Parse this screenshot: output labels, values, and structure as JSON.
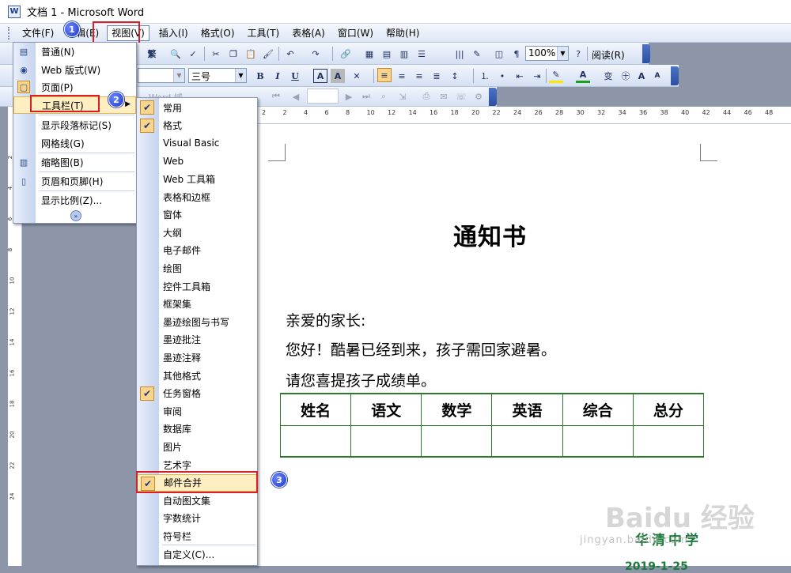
{
  "window": {
    "title": "文档 1 - Microsoft Word",
    "app_icon": "word-icon"
  },
  "menubar": {
    "items": [
      "文件(F)",
      "编辑(E)",
      "视图(V)",
      "插入(I)",
      "格式(O)",
      "工具(T)",
      "表格(A)",
      "窗口(W)",
      "帮助(H)"
    ],
    "active_index": 2
  },
  "toolbar_standard": {
    "fanti": "繁",
    "zoom": "100%",
    "reading": "阅读(R)"
  },
  "toolbar_format": {
    "font_size": "三号",
    "bold": "B",
    "italic": "I",
    "underline": "U",
    "char_border": "A",
    "char_shade": "A",
    "font_color": "A",
    "grow": "A",
    "shrink": "A",
    "phonetic": "变"
  },
  "toolbar_third": {
    "label": "Word 域"
  },
  "view_menu": {
    "items": [
      {
        "label": "普通(N)",
        "icon": "normal-view-icon"
      },
      {
        "label": "Web 版式(W)",
        "icon": "web-layout-icon"
      },
      {
        "label": "页面(P)",
        "icon": "print-layout-icon"
      },
      {
        "label": "工具栏(T)",
        "icon": ""
      },
      {
        "label": "显示段落标记(S)",
        "icon": ""
      },
      {
        "label": "网格线(G)",
        "icon": ""
      },
      {
        "label": "缩略图(B)",
        "icon": "thumbnail-icon"
      },
      {
        "label": "页眉和页脚(H)",
        "icon": "header-footer-icon"
      },
      {
        "label": "显示比例(Z)...",
        "icon": ""
      }
    ],
    "expand_icon": "chevron-double-down-icon"
  },
  "toolbars_submenu": {
    "items": [
      {
        "label": "常用",
        "checked": true
      },
      {
        "label": "格式",
        "checked": true
      },
      {
        "label": "Visual Basic",
        "checked": false
      },
      {
        "label": "Web",
        "checked": false
      },
      {
        "label": "Web 工具箱",
        "checked": false
      },
      {
        "label": "表格和边框",
        "checked": false
      },
      {
        "label": "窗体",
        "checked": false
      },
      {
        "label": "大纲",
        "checked": false
      },
      {
        "label": "电子邮件",
        "checked": false
      },
      {
        "label": "绘图",
        "checked": false
      },
      {
        "label": "控件工具箱",
        "checked": false
      },
      {
        "label": "框架集",
        "checked": false
      },
      {
        "label": "墨迹绘图与书写",
        "checked": false
      },
      {
        "label": "墨迹批注",
        "checked": false
      },
      {
        "label": "墨迹注释",
        "checked": false
      },
      {
        "label": "其他格式",
        "checked": false
      },
      {
        "label": "任务窗格",
        "checked": true
      },
      {
        "label": "审阅",
        "checked": false
      },
      {
        "label": "数据库",
        "checked": false
      },
      {
        "label": "图片",
        "checked": false
      },
      {
        "label": "艺术字",
        "checked": false
      },
      {
        "label": "邮件合并",
        "checked": true
      },
      {
        "label": "自动图文集",
        "checked": false
      },
      {
        "label": "字数统计",
        "checked": false
      },
      {
        "label": "符号栏",
        "checked": false
      },
      {
        "label": "自定义(C)...",
        "checked": false
      }
    ],
    "highlight_index": 21
  },
  "step_badges": [
    "1",
    "2",
    "3"
  ],
  "ruler": {
    "numbers": [
      "2",
      "2",
      "4",
      "6",
      "8",
      "10",
      "12",
      "14",
      "16",
      "18",
      "20",
      "22",
      "24",
      "26",
      "28",
      "30",
      "32",
      "34",
      "36",
      "38",
      "40",
      "42",
      "44",
      "46",
      "48"
    ],
    "vnumbers": [
      "2",
      "4",
      "6",
      "8",
      "10",
      "12",
      "14",
      "16",
      "18",
      "20",
      "22",
      "24"
    ]
  },
  "document": {
    "title": "通知书",
    "lines": [
      "亲爱的家长:",
      "您好！酷暑已经到来，孩子需回家避暑。",
      "请您喜提孩子成绩单。"
    ],
    "table": {
      "headers": [
        "姓名",
        "语文",
        "数学",
        "英语",
        "综合",
        "总分"
      ]
    },
    "school": "华清中学",
    "date": "2019-1-25"
  },
  "watermark": {
    "brand": "Baidu 经验",
    "url": "jingyan.baidu.com"
  }
}
